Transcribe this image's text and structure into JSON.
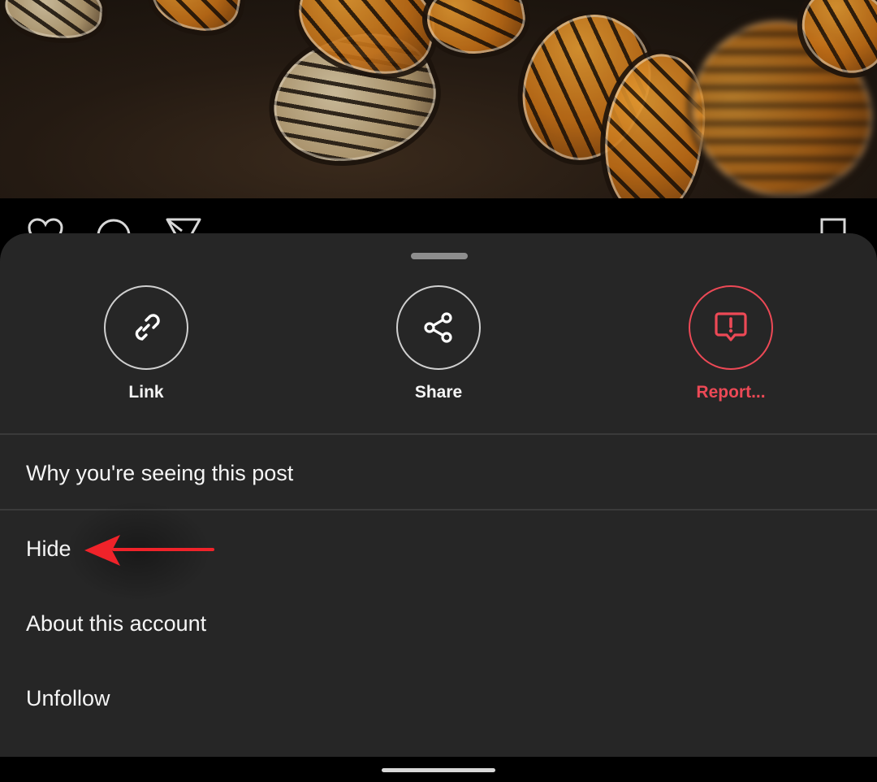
{
  "photo": {
    "subject": "monarch butterflies on ground"
  },
  "post_actions": {
    "icons": [
      "heart-icon",
      "comment-icon",
      "send-icon",
      "bookmark-icon"
    ]
  },
  "sheet": {
    "quick_actions": [
      {
        "label": "Link",
        "icon": "link-icon",
        "style": "normal"
      },
      {
        "label": "Share",
        "icon": "share-icon",
        "style": "normal"
      },
      {
        "label": "Report...",
        "icon": "report-icon",
        "style": "danger"
      }
    ],
    "menu_items": [
      {
        "label": "Why you're seeing this post"
      },
      {
        "label": "Hide"
      },
      {
        "label": "About this account"
      },
      {
        "label": "Unfollow"
      }
    ]
  },
  "annotation": {
    "target": "Hide",
    "color": "#f0232a"
  },
  "colors": {
    "sheet_bg": "#262626",
    "danger": "#ed4956",
    "text": "#f5f5f5"
  }
}
